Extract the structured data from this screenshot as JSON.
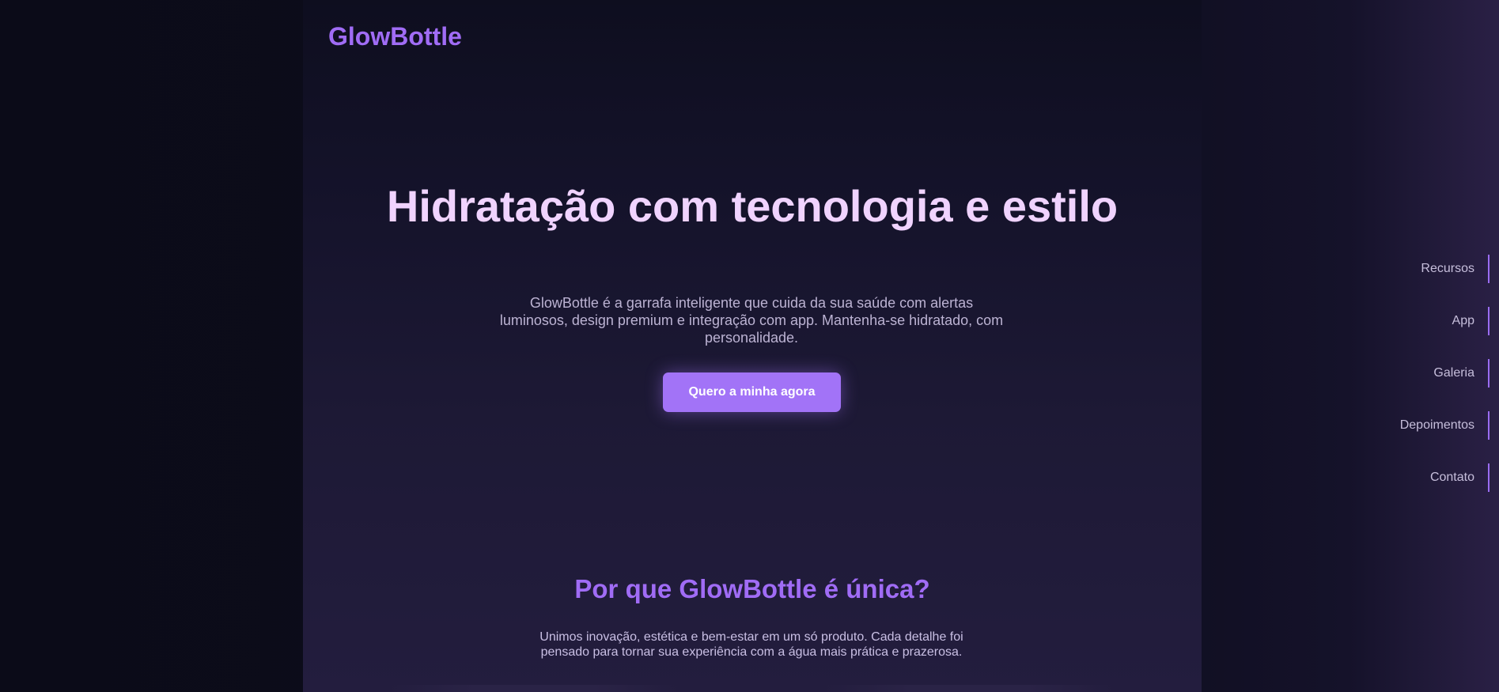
{
  "header": {
    "logo": "GlowBottle"
  },
  "hero": {
    "title": "Hidratação com tecnologia e estilo",
    "subtitle": "GlowBottle é a garrafa inteligente que cuida da sua saúde com alertas luminosos, design premium e integração com app. Mantenha-se hidratado, com personalidade.",
    "cta_label": "Quero a minha agora"
  },
  "features": {
    "title": "Por que GlowBottle é única?",
    "subtitle": "Unimos inovação, estética e bem-estar em um só produto. Cada detalhe foi pensado para tornar sua experiência com a água mais prática e prazerosa."
  },
  "side_nav": {
    "items": [
      {
        "label": "Recursos"
      },
      {
        "label": "App"
      },
      {
        "label": "Galeria"
      },
      {
        "label": "Depoimentos"
      },
      {
        "label": "Contato"
      }
    ]
  },
  "colors": {
    "accent": "#a273f7",
    "logo": "#a06cf5",
    "hero_title": "#f0d3ff",
    "background": "#0c0c1b"
  }
}
